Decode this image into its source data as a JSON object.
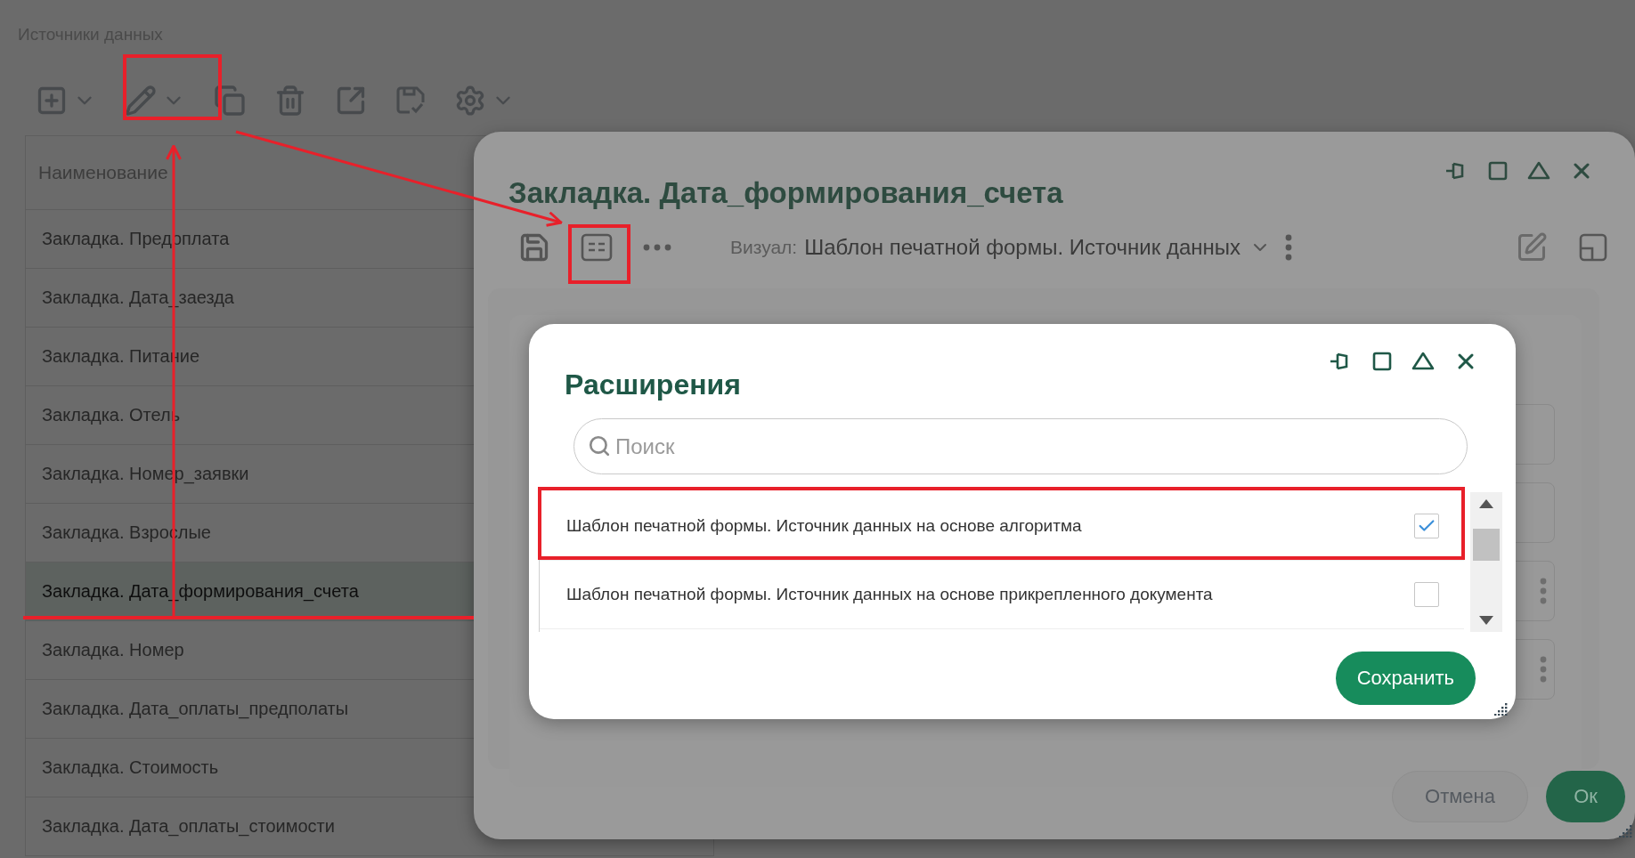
{
  "page": {
    "title": "Источники данных"
  },
  "table": {
    "columns": [
      "Наименование"
    ],
    "rows": [
      {
        "cells": [
          "Закладка. Предоплата"
        ],
        "selected": false
      },
      {
        "cells": [
          "Закладка. Дата_заезда"
        ],
        "selected": false
      },
      {
        "cells": [
          "Закладка. Питание"
        ],
        "selected": false
      },
      {
        "cells": [
          "Закладка. Отель"
        ],
        "selected": false
      },
      {
        "cells": [
          "Закладка. Номер_заявки"
        ],
        "selected": false
      },
      {
        "cells": [
          "Закладка. Взрослые"
        ],
        "selected": false
      },
      {
        "cells": [
          "Закладка. Дата_формирования_счета"
        ],
        "selected": true
      },
      {
        "cells": [
          "Закладка. Номер"
        ],
        "selected": false
      },
      {
        "cells": [
          "Закладка. Дата_оплаты_предполаты"
        ],
        "selected": false
      },
      {
        "cells": [
          "Закладка. Стоимость"
        ],
        "selected": false
      },
      {
        "cells": [
          "Закладка. Дата_оплаты_стоимости"
        ],
        "selected": false
      }
    ]
  },
  "dialog": {
    "title": "Закладка. Дата_формирования_счета",
    "visual_label": "Визуал:",
    "visual_value": "Шаблон печатной формы. Источник данных",
    "buttons": [
      {
        "label": "Отмена",
        "kind": "secondary"
      },
      {
        "label": "Ок",
        "kind": "primary"
      }
    ]
  },
  "extensions_dialog": {
    "title": "Расширения",
    "search": {
      "placeholder": "Поиск"
    },
    "items": [
      {
        "label": "Шаблон печатной формы. Источник данных на основе алгоритма",
        "checked": true
      },
      {
        "label": "Шаблон печатной формы. Источник данных на основе прикрепленного документа",
        "checked": false
      }
    ],
    "buttons": [
      {
        "label": "Сохранить",
        "kind": "primary"
      }
    ]
  }
}
